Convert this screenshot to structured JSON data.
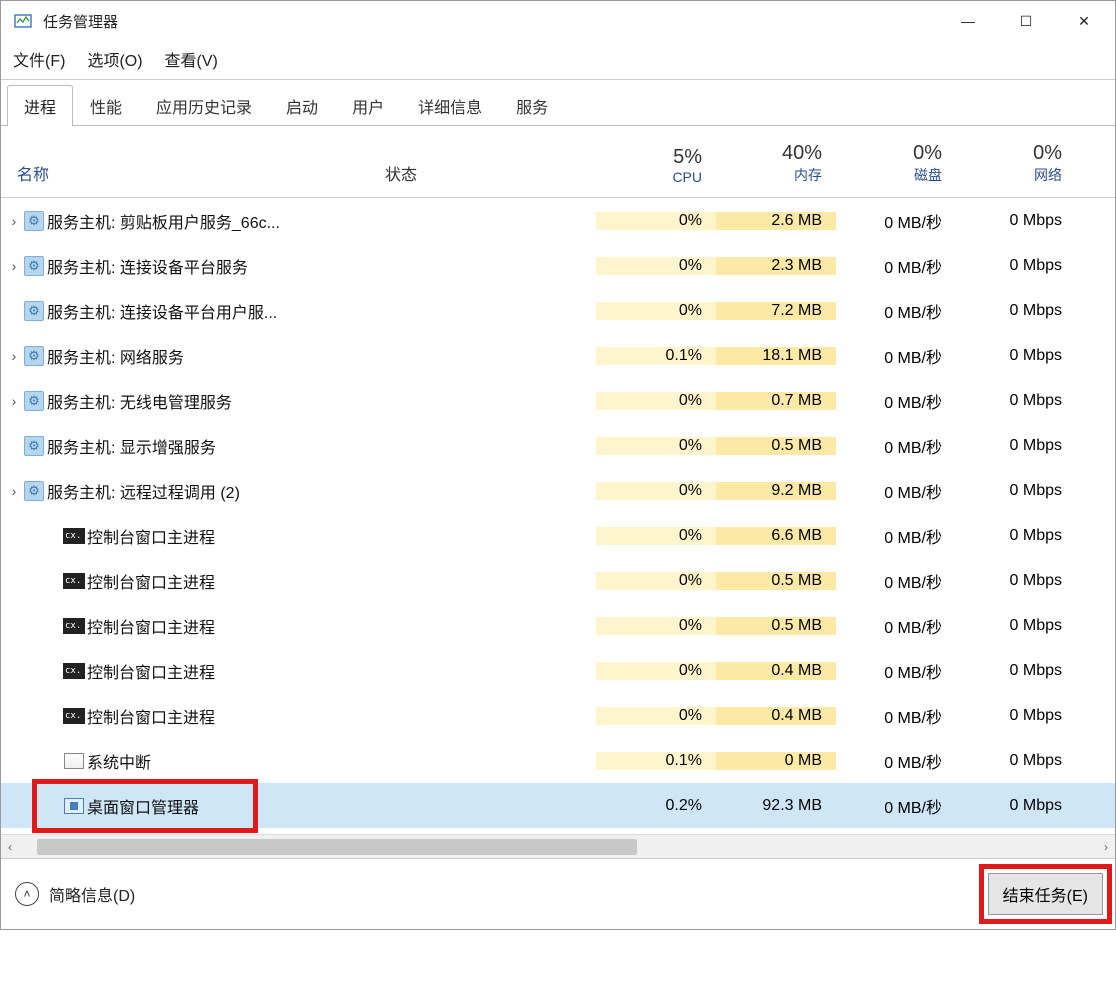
{
  "window": {
    "title": "任务管理器",
    "minimize": "—",
    "maximize": "☐",
    "close": "✕"
  },
  "menubar": {
    "file": "文件(F)",
    "options": "选项(O)",
    "view": "查看(V)"
  },
  "tabs": {
    "processes": "进程",
    "performance": "性能",
    "history": "应用历史记录",
    "startup": "启动",
    "users": "用户",
    "details": "详细信息",
    "services": "服务"
  },
  "columns": {
    "name": "名称",
    "status": "状态",
    "cpu_pct": "5%",
    "cpu_label": "CPU",
    "mem_pct": "40%",
    "mem_label": "内存",
    "disk_pct": "0%",
    "disk_label": "磁盘",
    "net_pct": "0%",
    "net_label": "网络"
  },
  "rows": [
    {
      "exp": "›",
      "icon": "gear",
      "name": "服务主机: 剪贴板用户服务_66c...",
      "cpu": "0%",
      "mem": "2.6 MB",
      "disk": "0 MB/秒",
      "net": "0 Mbps"
    },
    {
      "exp": "›",
      "icon": "gear",
      "name": "服务主机: 连接设备平台服务",
      "cpu": "0%",
      "mem": "2.3 MB",
      "disk": "0 MB/秒",
      "net": "0 Mbps"
    },
    {
      "exp": "",
      "icon": "gear",
      "name": "服务主机: 连接设备平台用户服...",
      "cpu": "0%",
      "mem": "7.2 MB",
      "disk": "0 MB/秒",
      "net": "0 Mbps"
    },
    {
      "exp": "›",
      "icon": "gear",
      "name": "服务主机: 网络服务",
      "cpu": "0.1%",
      "mem": "18.1 MB",
      "disk": "0 MB/秒",
      "net": "0 Mbps"
    },
    {
      "exp": "›",
      "icon": "gear",
      "name": "服务主机: 无线电管理服务",
      "cpu": "0%",
      "mem": "0.7 MB",
      "disk": "0 MB/秒",
      "net": "0 Mbps"
    },
    {
      "exp": "",
      "icon": "gear",
      "name": "服务主机: 显示增强服务",
      "cpu": "0%",
      "mem": "0.5 MB",
      "disk": "0 MB/秒",
      "net": "0 Mbps"
    },
    {
      "exp": "›",
      "icon": "gear",
      "name": "服务主机: 远程过程调用 (2)",
      "cpu": "0%",
      "mem": "9.2 MB",
      "disk": "0 MB/秒",
      "net": "0 Mbps"
    },
    {
      "exp": "",
      "icon": "console",
      "name": "控制台窗口主进程",
      "cpu": "0%",
      "mem": "6.6 MB",
      "disk": "0 MB/秒",
      "net": "0 Mbps",
      "indent": true
    },
    {
      "exp": "",
      "icon": "console",
      "name": "控制台窗口主进程",
      "cpu": "0%",
      "mem": "0.5 MB",
      "disk": "0 MB/秒",
      "net": "0 Mbps",
      "indent": true
    },
    {
      "exp": "",
      "icon": "console",
      "name": "控制台窗口主进程",
      "cpu": "0%",
      "mem": "0.5 MB",
      "disk": "0 MB/秒",
      "net": "0 Mbps",
      "indent": true
    },
    {
      "exp": "",
      "icon": "console",
      "name": "控制台窗口主进程",
      "cpu": "0%",
      "mem": "0.4 MB",
      "disk": "0 MB/秒",
      "net": "0 Mbps",
      "indent": true
    },
    {
      "exp": "",
      "icon": "console",
      "name": "控制台窗口主进程",
      "cpu": "0%",
      "mem": "0.4 MB",
      "disk": "0 MB/秒",
      "net": "0 Mbps",
      "indent": true
    },
    {
      "exp": "",
      "icon": "sys",
      "name": "系统中断",
      "cpu": "0.1%",
      "mem": "0 MB",
      "disk": "0 MB/秒",
      "net": "0 Mbps",
      "indent": true
    },
    {
      "exp": "",
      "icon": "dwm",
      "name": "桌面窗口管理器",
      "cpu": "0.2%",
      "mem": "92.3 MB",
      "disk": "0 MB/秒",
      "net": "0 Mbps",
      "indent": true,
      "selected": true,
      "redbox": true
    }
  ],
  "footer": {
    "less": "简略信息(D)",
    "end_task": "结束任务(E)"
  }
}
